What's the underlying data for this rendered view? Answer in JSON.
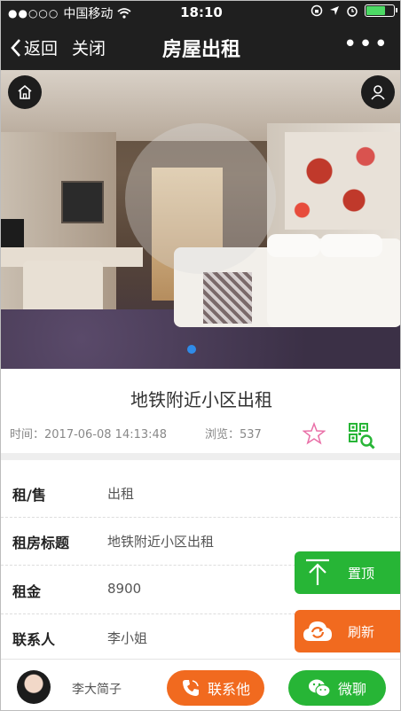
{
  "status_bar": {
    "carrier": "中国移动",
    "time": "18:10"
  },
  "nav": {
    "back_label": "返回",
    "close_label": "关闭",
    "title": "房屋出租",
    "more_label": "•••"
  },
  "listing": {
    "headline": "地铁附近小区出租",
    "time_text": "时间：2017-06-08 14:13:48",
    "views_text": "浏览：537",
    "fields": [
      {
        "label": "租/售",
        "value": "出租"
      },
      {
        "label": "租房标题",
        "value": "地铁附近小区出租"
      },
      {
        "label": "租金",
        "value": "8900"
      },
      {
        "label": "联系人",
        "value": "李小姐"
      }
    ]
  },
  "floating": {
    "pin_label": "置顶",
    "refresh_label": "刷新"
  },
  "bottom_bar": {
    "user_name": "李大简子",
    "call_label": "联系他",
    "chat_label": "微聊"
  },
  "colors": {
    "green": "#27b536",
    "orange": "#f16a1f",
    "dark": "#1f1f1f",
    "indicator": "#2f8be8"
  },
  "icons": [
    "home-icon",
    "user-icon",
    "star-icon",
    "qr-search-icon",
    "arrow-up-icon",
    "refresh-icon",
    "phone-icon",
    "wechat-icon"
  ]
}
